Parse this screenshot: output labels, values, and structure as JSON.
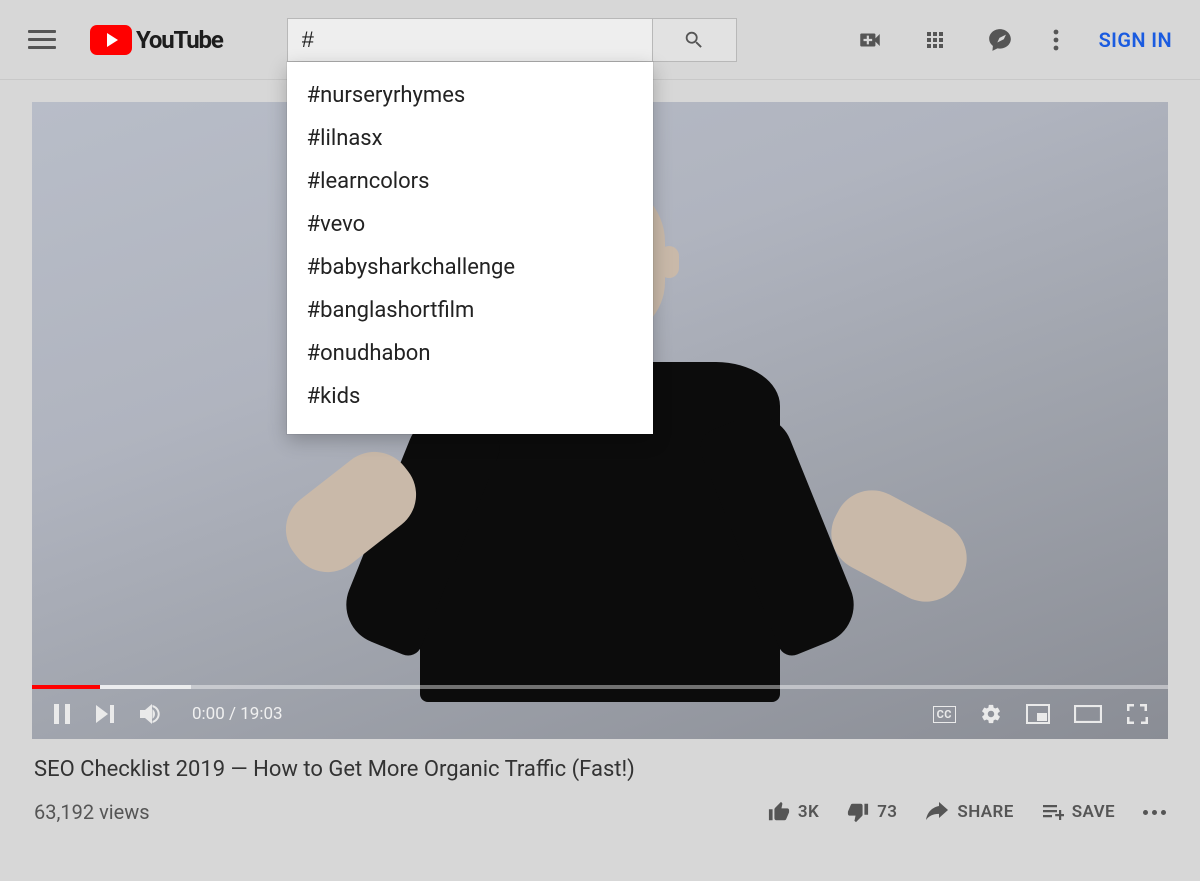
{
  "header": {
    "logo_text": "YouTube",
    "search_value": "#",
    "sign_in": "SIGN IN",
    "suggestions": [
      "#nurseryrhymes",
      "#lilnasx",
      "#learncolors",
      "#vevo",
      "#babysharkchallenge",
      "#banglashortfilm",
      "#onudhabon",
      "#kids"
    ]
  },
  "player": {
    "current_time": "0:00",
    "duration": "19:03",
    "cc_label": "CC"
  },
  "video": {
    "title": "SEO Checklist 2019 — How to Get More Organic Traffic (Fast!)",
    "views": "63,192 views"
  },
  "actions": {
    "likes": "3K",
    "dislikes": "73",
    "share": "SHARE",
    "save": "SAVE"
  }
}
